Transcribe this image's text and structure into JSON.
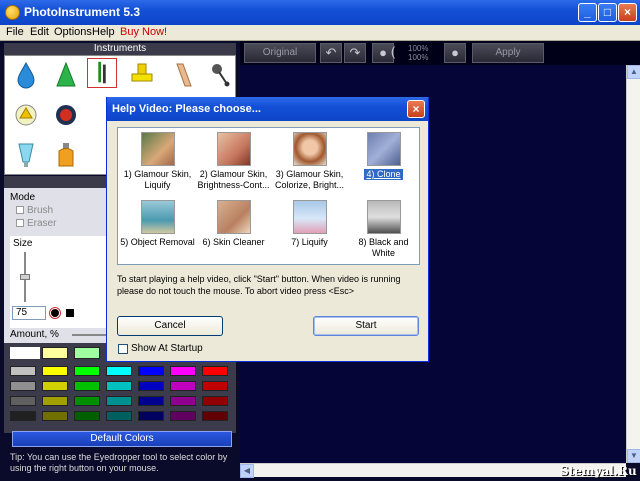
{
  "app": {
    "title": "PhotoInstrument 5.3"
  },
  "menu": [
    "File",
    "Edit",
    "Options",
    "Help",
    "Buy Now!"
  ],
  "toolbar": {
    "original_label": "Original",
    "apply_label": "Apply",
    "zoom_a": "100%",
    "zoom_b": "100%"
  },
  "instruments": {
    "header": "Instruments"
  },
  "mode_panel": {
    "mode_label": "Mode",
    "brush_label": "Brush",
    "eraser_label": "Eraser",
    "size_label": "Size",
    "size_value": "75",
    "amount_label": "Amount, %"
  },
  "palette": {
    "default_colors_label": "Default Colors",
    "tip": "Tip: You can use the Eyedropper tool to select color by using the right button on your mouse.",
    "colors": [
      [
        "#ffffff",
        "#ffffa0",
        "#a0ffa0"
      ],
      [
        "#c0c0c0",
        "#ffff00",
        "#00ff00",
        "#00ffff",
        "#0000ff",
        "#ff00ff",
        "#ff0000"
      ],
      [
        "#909090",
        "#d0d000",
        "#00c000",
        "#00c0c0",
        "#0000c0",
        "#c000c0",
        "#c00000"
      ],
      [
        "#606060",
        "#a0a000",
        "#009000",
        "#009090",
        "#000090",
        "#900090",
        "#900000"
      ],
      [
        "#202020",
        "#707000",
        "#006000",
        "#006060",
        "#000060",
        "#600060",
        "#600000"
      ]
    ]
  },
  "dialog": {
    "title": "Help Video: Please choose...",
    "videos": [
      {
        "label": "1) Glamour Skin, Liquify"
      },
      {
        "label": "2) Glamour Skin, Brightness-Cont..."
      },
      {
        "label": "3) Glamour Skin, Colorize, Bright..."
      },
      {
        "label": "4) Clone"
      },
      {
        "label": "5) Object Removal"
      },
      {
        "label": "6) Skin Cleaner"
      },
      {
        "label": "7) Liquify"
      },
      {
        "label": "8) Black and White"
      }
    ],
    "info": "To start playing a help video, click \"Start\" button. When video is running please do not touch the mouse. To abort video press <Esc>",
    "cancel_label": "Cancel",
    "start_label": "Start",
    "show_startup_label": "Show At Startup"
  },
  "watermark": "Stemyal.Ru"
}
